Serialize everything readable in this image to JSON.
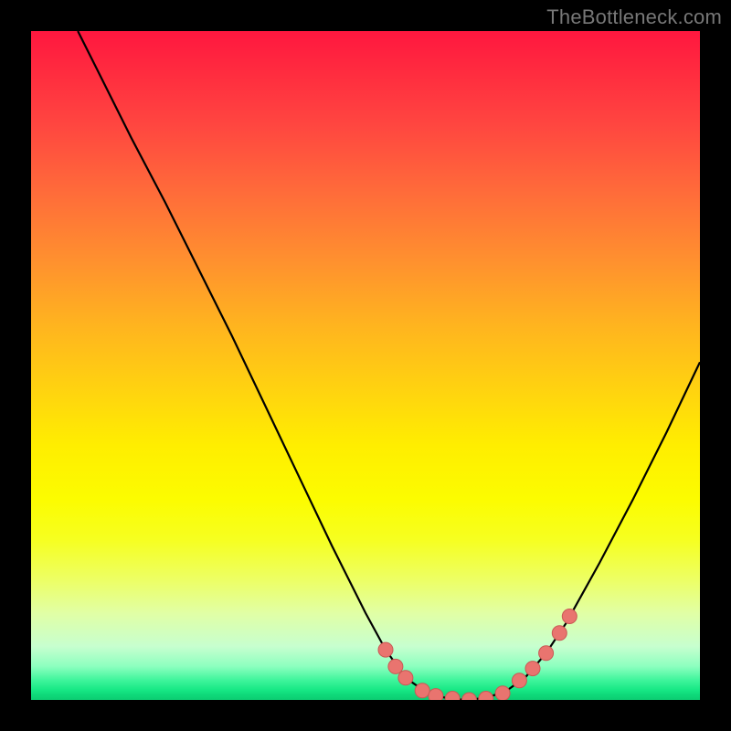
{
  "watermark": "TheBottleneck.com",
  "colors": {
    "background": "#000000",
    "curve_stroke": "#000000",
    "marker_fill": "#e9746f",
    "marker_stroke": "#c95955",
    "gradient_top": "#ff173f",
    "gradient_bottom": "#0ccc72"
  },
  "chart_data": {
    "type": "line",
    "title": "",
    "xlabel": "",
    "ylabel": "",
    "xlim": [
      0,
      100
    ],
    "ylim": [
      0,
      100
    ],
    "grid": false,
    "legend": false,
    "curve": [
      {
        "x": 7.0,
        "y": 100.0
      },
      {
        "x": 10.0,
        "y": 94.0
      },
      {
        "x": 15.0,
        "y": 84.0
      },
      {
        "x": 20.0,
        "y": 74.5
      },
      {
        "x": 25.0,
        "y": 64.5
      },
      {
        "x": 30.0,
        "y": 54.5
      },
      {
        "x": 35.0,
        "y": 44.0
      },
      {
        "x": 40.0,
        "y": 33.5
      },
      {
        "x": 45.0,
        "y": 23.0
      },
      {
        "x": 50.0,
        "y": 13.0
      },
      {
        "x": 53.0,
        "y": 7.5
      },
      {
        "x": 56.0,
        "y": 3.3
      },
      {
        "x": 59.0,
        "y": 1.2
      },
      {
        "x": 62.0,
        "y": 0.3
      },
      {
        "x": 65.0,
        "y": 0.0
      },
      {
        "x": 68.0,
        "y": 0.3
      },
      {
        "x": 71.0,
        "y": 1.3
      },
      {
        "x": 74.0,
        "y": 3.5
      },
      {
        "x": 77.0,
        "y": 7.0
      },
      {
        "x": 80.0,
        "y": 11.5
      },
      {
        "x": 85.0,
        "y": 20.5
      },
      {
        "x": 90.0,
        "y": 30.0
      },
      {
        "x": 95.0,
        "y": 40.0
      },
      {
        "x": 100.0,
        "y": 50.5
      }
    ],
    "markers": [
      {
        "x": 53.0,
        "y": 7.5
      },
      {
        "x": 54.5,
        "y": 5.0
      },
      {
        "x": 56.0,
        "y": 3.3
      },
      {
        "x": 58.5,
        "y": 1.4
      },
      {
        "x": 60.5,
        "y": 0.6
      },
      {
        "x": 63.0,
        "y": 0.2
      },
      {
        "x": 65.5,
        "y": 0.0
      },
      {
        "x": 68.0,
        "y": 0.2
      },
      {
        "x": 70.5,
        "y": 1.0
      },
      {
        "x": 73.0,
        "y": 2.9
      },
      {
        "x": 75.0,
        "y": 4.7
      },
      {
        "x": 77.0,
        "y": 7.0
      },
      {
        "x": 79.0,
        "y": 10.0
      },
      {
        "x": 80.5,
        "y": 12.5
      }
    ]
  }
}
